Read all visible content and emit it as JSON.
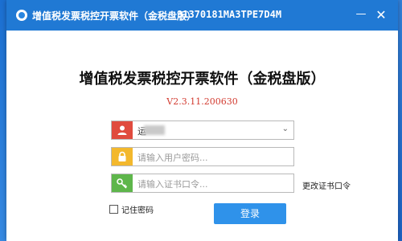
{
  "window": {
    "title": "增值税发票税控开票软件（金税盘版）",
    "taxpayer_id": "91370181MA3TPE7D4M",
    "minimize_label": "—",
    "close_label": "✕"
  },
  "login": {
    "heading": "增值税发票税控开票软件（金税盘版）",
    "version": "V2.3.11.200630",
    "user_value": "运",
    "password_placeholder": "请输入用户密码...",
    "cert_placeholder": "请输入证书口令...",
    "change_cert_label": "更改证书口令",
    "remember_label": "记住密码",
    "login_button": "登录"
  },
  "icons": {
    "user": "user-icon",
    "password": "lock-icon",
    "cert": "key-icon",
    "dropdown": "chevron-down-icon"
  },
  "colors": {
    "titlebar": "#2079d4",
    "user_icon": "#e04b3e",
    "lock_icon": "#f3b82d",
    "key_icon": "#5eb64b",
    "login_button": "#2f92ea",
    "version_text": "#d23a2f"
  }
}
